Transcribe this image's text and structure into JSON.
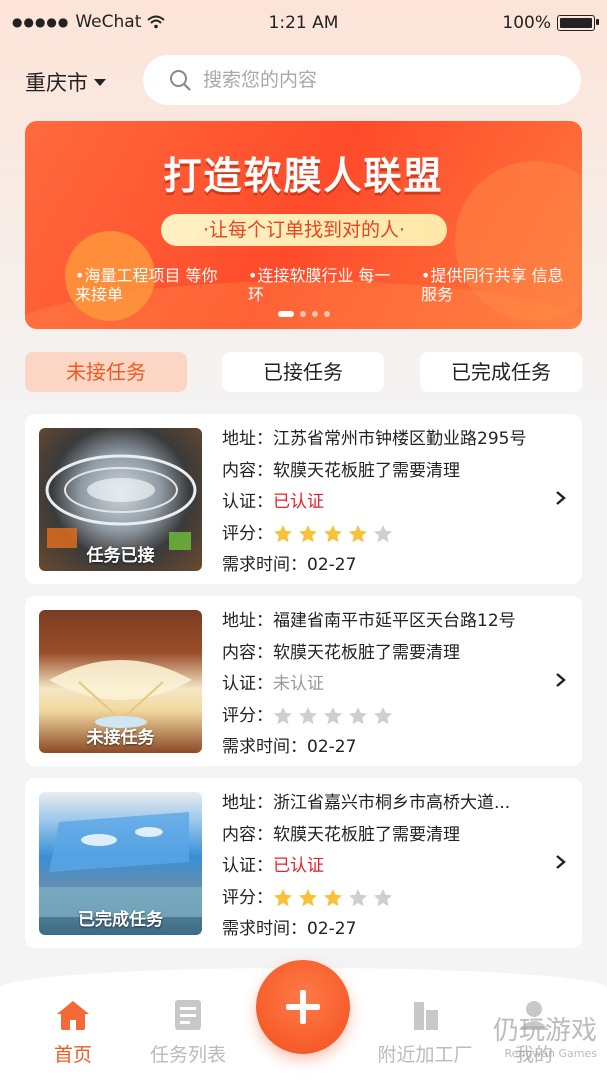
{
  "status_bar": {
    "signal": "●●●●●",
    "carrier": "WeChat",
    "time": "1:21 AM",
    "battery": "100%"
  },
  "header": {
    "city": "重庆市",
    "search_placeholder": "搜索您的内容"
  },
  "banner": {
    "title": "打造软膜人联盟",
    "subtitle": "·让每个订单找到对的人·",
    "features": [
      "•海量工程项目 等你来接单",
      "•连接软膜行业 每一环",
      "•提供同行共享 信息服务"
    ],
    "page_count": 4,
    "active_page": 1
  },
  "tabs": [
    {
      "label": "未接任务",
      "active": true
    },
    {
      "label": "已接任务",
      "active": false
    },
    {
      "label": "已完成任务",
      "active": false
    }
  ],
  "labels": {
    "address": "地址：",
    "content": "内容：",
    "cert": "认证：",
    "rating": "评分：",
    "time": "需求时间："
  },
  "tasks": [
    {
      "status_caption": "任务已接",
      "address": "江苏省常州市钟楼区勤业路295号",
      "content": "软膜天花板脏了需要清理",
      "certification": "已认证",
      "certified": true,
      "rating": 4,
      "rating_max": 5,
      "time": "02-27"
    },
    {
      "status_caption": "未接任务",
      "address": "福建省南平市延平区天台路12号",
      "content": "软膜天花板脏了需要清理",
      "certification": "未认证",
      "certified": false,
      "rating": 0,
      "rating_max": 5,
      "time": "02-27"
    },
    {
      "status_caption": "已完成任务",
      "address": "浙江省嘉兴市桐乡市高桥大道...",
      "content": "软膜天花板脏了需要清理",
      "certification": "已认证",
      "certified": true,
      "rating": 3,
      "rating_max": 5,
      "time": "02-27"
    }
  ],
  "tabbar": [
    {
      "label": "首页",
      "icon": "home-icon",
      "active": true
    },
    {
      "label": "任务列表",
      "icon": "task-list-icon",
      "active": false
    },
    {
      "label": "附近加工厂",
      "icon": "factory-icon",
      "active": false
    },
    {
      "label": "我的",
      "icon": "profile-icon",
      "active": false
    }
  ],
  "colors": {
    "accent": "#ef5a23",
    "star_on": "#f7c23a",
    "star_off": "#cfcfcf",
    "certified": "#e8202a"
  },
  "watermark": {
    "text": "仍玩游戏",
    "sub": "Rengwan Games"
  }
}
